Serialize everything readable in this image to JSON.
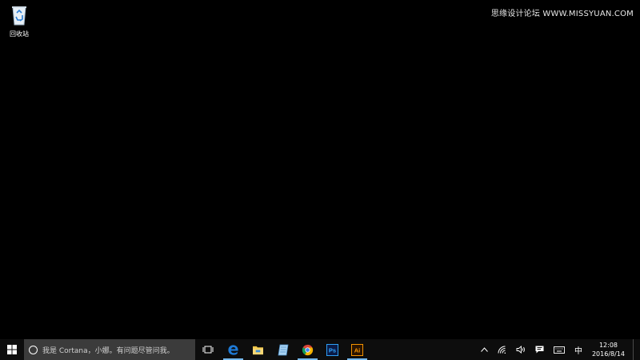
{
  "watermark": {
    "text": "思缘设计论坛 WWW.MISSYUAN.COM"
  },
  "desktop": {
    "icons": [
      {
        "label": "回收站",
        "icon": "recycle-bin-icon"
      }
    ]
  },
  "taskbar": {
    "start_icon": "windows-logo-icon",
    "search": {
      "placeholder": "我是 Cortana，小娜。有问题尽管问我。",
      "icon": "cortana-circle-icon"
    },
    "task_view_icon": "task-view-icon",
    "pinned": [
      {
        "name": "Microsoft Edge",
        "icon": "edge-icon",
        "active": true
      },
      {
        "name": "File Explorer",
        "icon": "folder-icon",
        "active": false
      },
      {
        "name": "Notepad",
        "icon": "notepad-icon",
        "active": false
      },
      {
        "name": "Google Chrome",
        "icon": "chrome-icon",
        "active": true
      },
      {
        "name": "Photoshop",
        "icon": "photoshop-icon",
        "label": "Ps",
        "active": false
      },
      {
        "name": "Illustrator",
        "icon": "illustrator-icon",
        "label": "Ai",
        "active": true
      }
    ],
    "tray": {
      "show_hidden_icon": "chevron-up-icon",
      "network_icon": "wifi-icon",
      "volume_icon": "speaker-icon",
      "action_center_icon": "notification-icon",
      "keyboard_icon": "keyboard-icon",
      "ime_label": "中",
      "time": "12:08",
      "date": "2016/8/14"
    }
  },
  "colors": {
    "desktop_bg": "#000000",
    "taskbar_bg": "#0d0d0d",
    "search_bg": "#3b3b3b",
    "active_indicator": "#76b9ed",
    "edge_blue": "#1e7ad6",
    "photoshop_bg": "#0a1a45",
    "photoshop_text": "#31a8ff",
    "illustrator_bg": "#2a1400",
    "illustrator_text": "#ff9a00"
  }
}
